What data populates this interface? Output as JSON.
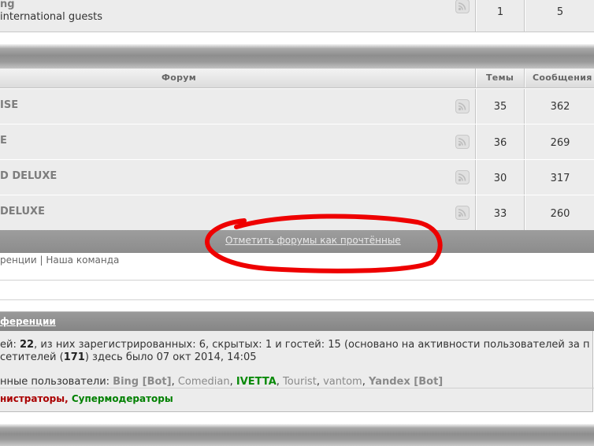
{
  "top_forum": {
    "title_fragment": "ng",
    "description_fragment": "international guests",
    "topics": "1",
    "posts": "5"
  },
  "forum_table": {
    "header": {
      "forum": "Форум",
      "topics": "Темы",
      "posts": "Сообщения"
    },
    "rows": [
      {
        "title_fragment": "ISE",
        "topics": "35",
        "posts": "362"
      },
      {
        "title_fragment": "E",
        "topics": "36",
        "posts": "269"
      },
      {
        "title_fragment": "D DELUXE",
        "topics": "30",
        "posts": "317"
      },
      {
        "title_fragment": "DELUXE",
        "topics": "33",
        "posts": "260"
      }
    ],
    "mark_read_link": "Отметить форумы как прочтённые"
  },
  "footer_links": {
    "conference_fragment": "ренции",
    "separator": "|",
    "team": "Наша команда"
  },
  "stats": {
    "header_link_fragment": "ференции",
    "online": {
      "prefix_fragment": "ей:",
      "total": "22",
      "text_registered": ", из них зарегистрированных: 6, скрытых: 1 и гостей: 15 (основано на активности пользователей за п"
    },
    "record": {
      "prefix_fragment": "сетителей (",
      "count": "171",
      "suffix": ") здесь было 07 окт 2014, 14:05"
    },
    "users_label_fragment": "нные пользователи:",
    "users": [
      {
        "name": "Bing [Bot]",
        "style": "greybold"
      },
      {
        "name": "Comedian",
        "style": "grey"
      },
      {
        "name": "IVETTA",
        "style": "green"
      },
      {
        "name": "Tourist",
        "style": "grey"
      },
      {
        "name": "vantom",
        "style": "grey"
      },
      {
        "name": "Yandex [Bot]",
        "style": "greybold"
      }
    ],
    "legend": {
      "admins_fragment": "нистраторы",
      "separator": ",",
      "moderators": "Супермодераторы"
    }
  },
  "colors": {
    "admin": "#aa0000",
    "moderator": "#008000",
    "annotation": "#ee0000"
  },
  "icons": {
    "feed": "rss-feed-icon"
  }
}
